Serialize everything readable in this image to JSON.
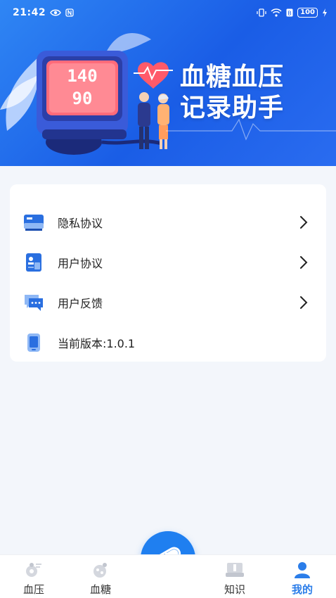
{
  "status_bar": {
    "time": "21:42",
    "battery": "100"
  },
  "banner": {
    "title_line1": "血糖血压",
    "title_line2": "记录助手",
    "monitor_sys": "140",
    "monitor_dia": "90"
  },
  "menu": {
    "items": [
      {
        "label": "隐私协议",
        "icon": "privacy-icon",
        "has_arrow": true
      },
      {
        "label": "用户协议",
        "icon": "agreement-icon",
        "has_arrow": true
      },
      {
        "label": "用户反馈",
        "icon": "feedback-icon",
        "has_arrow": true
      },
      {
        "label": "当前版本:1.0.1",
        "icon": "phone-icon",
        "has_arrow": false
      }
    ]
  },
  "bottom_nav": {
    "items": [
      {
        "label": "血压",
        "icon": "blood-pressure-icon",
        "active": false
      },
      {
        "label": "血糖",
        "icon": "blood-sugar-icon",
        "active": false
      },
      {
        "label": "知识",
        "icon": "knowledge-icon",
        "active": false
      },
      {
        "label": "我的",
        "icon": "profile-icon",
        "active": true
      }
    ],
    "fab_icon": "pill-icon"
  },
  "colors": {
    "accent": "#2b7de9",
    "banner": "#1a5de6",
    "background": "#f3f6fb"
  }
}
